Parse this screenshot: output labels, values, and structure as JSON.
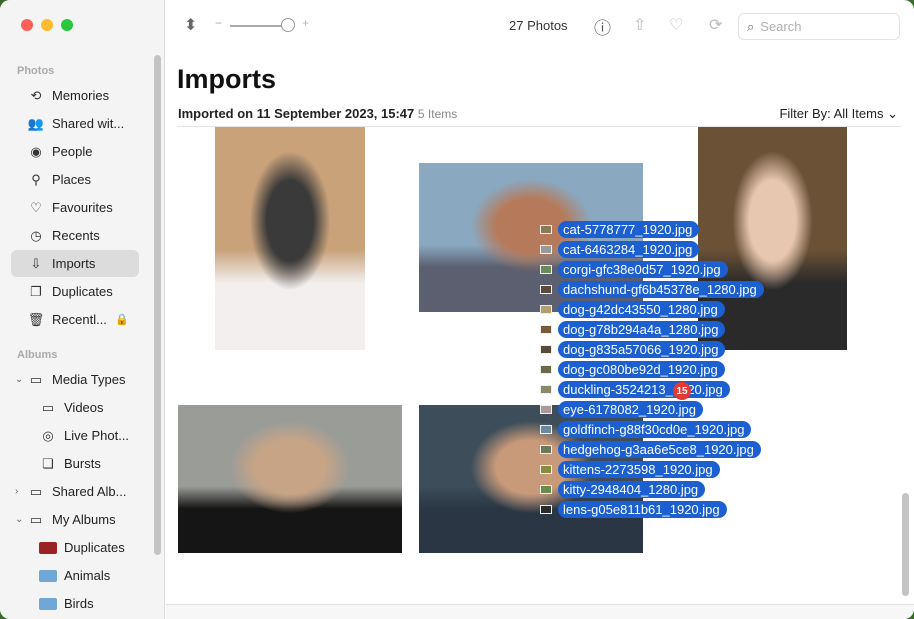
{
  "window": {
    "title": "Photos"
  },
  "sidebar": {
    "sections": [
      {
        "label": "Photos"
      },
      {
        "label": "Albums"
      }
    ],
    "photos_items": [
      {
        "label": "Memories",
        "icon": "memories-icon",
        "glyph": "⟲"
      },
      {
        "label": "Shared wit...",
        "icon": "shared-with-you-icon",
        "glyph": "👥"
      },
      {
        "label": "People",
        "icon": "people-icon",
        "glyph": "◉"
      },
      {
        "label": "Places",
        "icon": "places-icon",
        "glyph": "⚲"
      },
      {
        "label": "Favourites",
        "icon": "heart-icon",
        "glyph": "♡"
      },
      {
        "label": "Recents",
        "icon": "clock-icon",
        "glyph": "◷"
      },
      {
        "label": "Imports",
        "icon": "import-icon",
        "glyph": "⇩",
        "active": true
      },
      {
        "label": "Duplicates",
        "icon": "duplicates-icon",
        "glyph": "❐"
      },
      {
        "label": "Recentl...",
        "icon": "trash-icon",
        "glyph": "🗑",
        "locked": true
      }
    ],
    "album_items": [
      {
        "label": "Media Types",
        "icon": "album-stack-icon",
        "glyph": "▭",
        "chevron": "⌄"
      },
      {
        "label": "Videos",
        "icon": "video-icon",
        "glyph": "▭"
      },
      {
        "label": "Live Phot...",
        "icon": "live-photo-icon",
        "glyph": "◎"
      },
      {
        "label": "Bursts",
        "icon": "bursts-icon",
        "glyph": "❏"
      },
      {
        "label": "Shared Alb...",
        "icon": "shared-album-icon",
        "glyph": "▭",
        "chevron": "›"
      },
      {
        "label": "My Albums",
        "icon": "album-stack-icon",
        "glyph": "▭",
        "chevron": "⌄"
      },
      {
        "label": "Duplicates",
        "icon": "album-thumb-duplicates",
        "thumb_color": "#9b2222"
      },
      {
        "label": "Animals",
        "icon": "album-thumb-animals",
        "thumb_color": "#6fa7d6"
      },
      {
        "label": "Birds",
        "icon": "album-thumb-birds",
        "thumb_color": "#6fa7d6"
      }
    ]
  },
  "toolbar": {
    "photo_count": "27 Photos",
    "zoom_minus": "−",
    "zoom_plus": "+",
    "zoom_level": 0.9,
    "search_placeholder": "Search"
  },
  "main": {
    "title": "Imports",
    "import_heading": "Imported on 11 September 2023, 15:47",
    "item_count": "5 Items",
    "filter_label": "Filter By: All Items",
    "filter_chevron": "⌄",
    "photos": [
      {
        "name": "man-with-glasses",
        "colors": [
          "#c9a27a",
          "#3a3a3a",
          "#f2efee"
        ]
      },
      {
        "name": "redhead-woman-lake",
        "colors": [
          "#8aa8c0",
          "#b67a5a",
          "#5b5f70"
        ]
      },
      {
        "name": "woman-striped-shirt",
        "colors": [
          "#6b5236",
          "#e8c7b0",
          "#2a2a2a"
        ]
      },
      {
        "name": "woman-brick-wall",
        "colors": [
          "#9a9c98",
          "#c7a486",
          "#151515"
        ]
      },
      {
        "name": "man-street",
        "colors": [
          "#3d4d5a",
          "#c99a7a",
          "#2a3644"
        ]
      }
    ],
    "drag_count": "15",
    "drag_files": [
      "cat-5778777_1920.jpg",
      "cat-6463284_1920.jpg",
      "corgi-gfc38e0d57_1920.jpg",
      "dachshund-gf6b45378e_1280.jpg",
      "dog-g42dc43550_1280.jpg",
      "dog-g78b294a4a_1280.jpg",
      "dog-g835a57066_1920.jpg",
      "dog-gc080be92d_1920.jpg",
      "duckling-3524213_1920.jpg",
      "eye-6178082_1920.jpg",
      "goldfinch-g88f30cd0e_1920.jpg",
      "hedgehog-g3aa6e5ce8_1920.jpg",
      "kittens-2273598_1920.jpg",
      "kitty-2948404_1280.jpg",
      "lens-g05e811b61_1920.jpg"
    ]
  },
  "colors": {
    "accent": "#1b5fd0",
    "badge": "#e33a35"
  }
}
